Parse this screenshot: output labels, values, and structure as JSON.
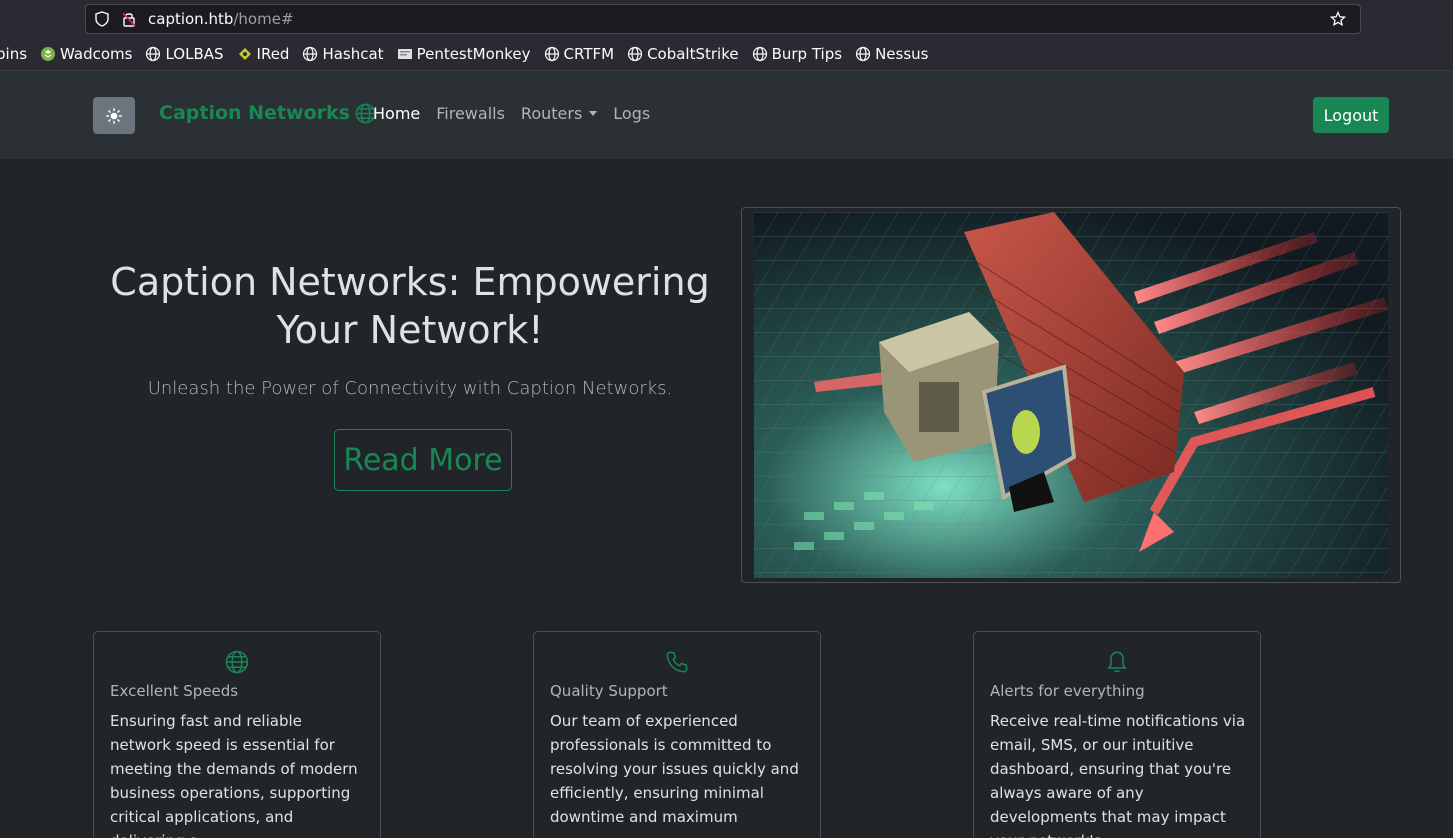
{
  "browser": {
    "url_host": "caption.htb",
    "url_path": "/home#",
    "bookmarks": [
      {
        "label": "bins",
        "icon": "globe-icon"
      },
      {
        "label": "Wadcoms",
        "icon": "wadcoms-icon"
      },
      {
        "label": "LOLBAS",
        "icon": "globe-icon"
      },
      {
        "label": "IRed",
        "icon": "ired-icon"
      },
      {
        "label": "Hashcat",
        "icon": "globe-icon"
      },
      {
        "label": "PentestMonkey",
        "icon": "page-icon"
      },
      {
        "label": "CRTFM",
        "icon": "globe-icon"
      },
      {
        "label": "CobaltStrike",
        "icon": "globe-icon"
      },
      {
        "label": "Burp Tips",
        "icon": "globe-icon"
      },
      {
        "label": "Nessus",
        "icon": "globe-icon"
      }
    ]
  },
  "navbar": {
    "theme_icon": "sun-icon",
    "brand": "Caption Networks",
    "links": [
      "Home",
      "Firewalls",
      "Routers",
      "Logs"
    ],
    "logout": "Logout"
  },
  "hero": {
    "title": "Caption Networks: Empowering Your Network!",
    "subtitle": "Unleash the Power of Connectivity with Caption Networks.",
    "cta": "Read More"
  },
  "cards": [
    {
      "icon": "globe-icon",
      "title": "Excellent Speeds",
      "text": "Ensuring fast and reliable network speed is essential for meeting the demands of modern business operations, supporting critical applications, and delivering a"
    },
    {
      "icon": "phone-icon",
      "title": "Quality Support",
      "text": "Our team of experienced professionals is committed to resolving your issues quickly and efficiently, ensuring minimal downtime and maximum"
    },
    {
      "icon": "bell-icon",
      "title": "Alerts for everything",
      "text": "Receive real-time notifications via email, SMS, or our intuitive dashboard, ensuring that you're always aware of any developments that may impact your network's"
    }
  ],
  "colors": {
    "accent": "#198754",
    "bg": "#212529",
    "navbar": "#2b3035"
  }
}
